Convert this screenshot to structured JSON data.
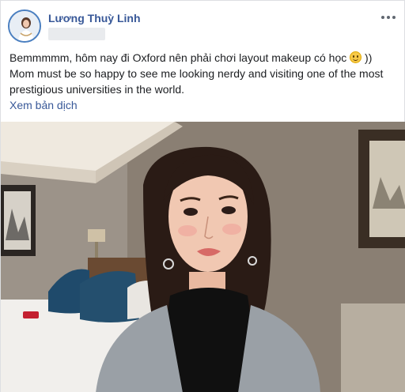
{
  "post": {
    "author_name": "Lương Thuỳ Linh",
    "text_line1": "Bemmmmm, hôm nay đi Oxford nên phải chơi layout makeup có học",
    "text_line1_suffix": "))",
    "text_line2": "Mom must be so happy to see me looking nerdy and visiting one of the most",
    "text_line3": "prestigious universities in the world.",
    "see_translation": "Xem bản dịch",
    "more_icon": "ellipsis-icon",
    "emoji_icon": "smiley-icon"
  },
  "colors": {
    "link_blue": "#385898",
    "text": "#1c1e21",
    "border": "#dddfe2"
  }
}
